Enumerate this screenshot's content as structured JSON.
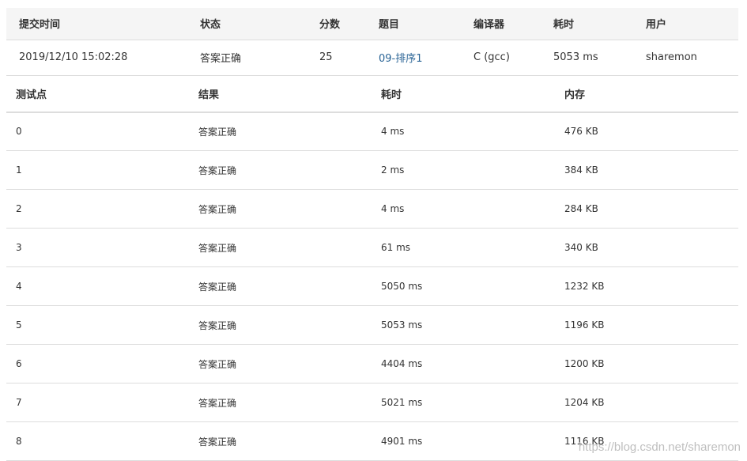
{
  "summary": {
    "headers": {
      "time": "提交时间",
      "status": "状态",
      "score": "分数",
      "problem": "题目",
      "compiler": "编译器",
      "elapsed": "耗时",
      "user": "用户"
    },
    "row": {
      "time": "2019/12/10 15:02:28",
      "status": "答案正确",
      "score": "25",
      "problem": "09-排序1",
      "compiler": "C (gcc)",
      "elapsed": "5053 ms",
      "user": "sharemon"
    }
  },
  "cases": {
    "headers": {
      "id": "测试点",
      "result": "结果",
      "time": "耗时",
      "memory": "内存"
    },
    "rows": [
      {
        "id": "0",
        "result": "答案正确",
        "time": "4 ms",
        "memory": "476 KB"
      },
      {
        "id": "1",
        "result": "答案正确",
        "time": "2 ms",
        "memory": "384 KB"
      },
      {
        "id": "2",
        "result": "答案正确",
        "time": "4 ms",
        "memory": "284 KB"
      },
      {
        "id": "3",
        "result": "答案正确",
        "time": "61 ms",
        "memory": "340 KB"
      },
      {
        "id": "4",
        "result": "答案正确",
        "time": "5050 ms",
        "memory": "1232 KB"
      },
      {
        "id": "5",
        "result": "答案正确",
        "time": "5053 ms",
        "memory": "1196 KB"
      },
      {
        "id": "6",
        "result": "答案正确",
        "time": "4404 ms",
        "memory": "1200 KB"
      },
      {
        "id": "7",
        "result": "答案正确",
        "time": "5021 ms",
        "memory": "1204 KB"
      },
      {
        "id": "8",
        "result": "答案正确",
        "time": "4901 ms",
        "memory": "1116 KB"
      }
    ]
  },
  "watermark": "https://blog.csdn.net/sharemon",
  "colors": {
    "accepted": "#e74c3c",
    "link": "#2a6496",
    "header_bg": "#f5f5f5",
    "border": "#dddddd"
  }
}
